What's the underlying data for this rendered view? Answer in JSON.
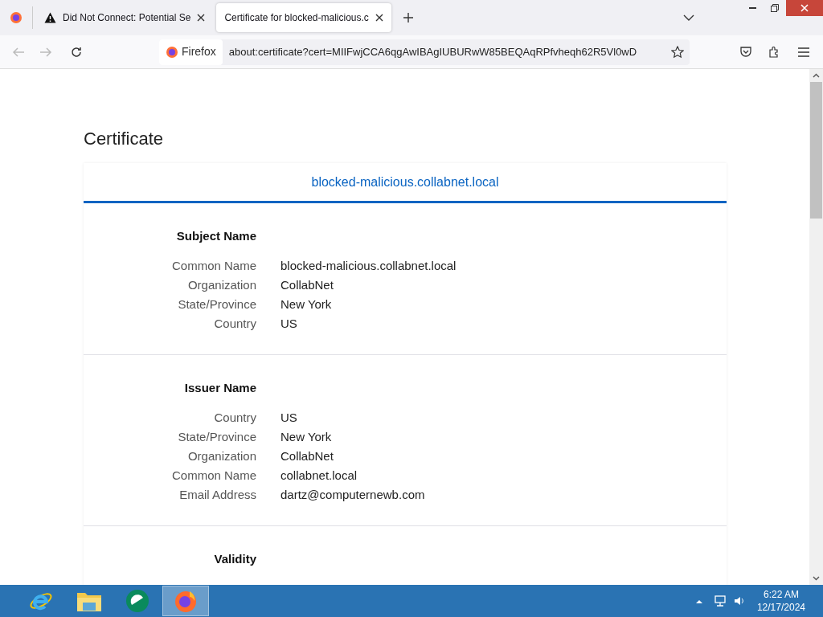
{
  "tabs": [
    {
      "label": "Did Not Connect: Potential Se",
      "kind": "warning",
      "selected": false
    },
    {
      "label": "Certificate for blocked-malicious.c",
      "kind": "plain",
      "selected": true
    }
  ],
  "address_bar": {
    "identity": "Firefox",
    "url": "about:certificate?cert=MIIFwjCCA6qgAwIBAgIUBURwW85BEQAqRPfvheqh62R5Vl0wD"
  },
  "page": {
    "title": "Certificate",
    "domain": "blocked-malicious.collabnet.local",
    "sections": [
      {
        "title": "Subject Name",
        "fields": [
          {
            "label": "Common Name",
            "value": "blocked-malicious.collabnet.local"
          },
          {
            "label": "Organization",
            "value": "CollabNet"
          },
          {
            "label": "State/Province",
            "value": "New York"
          },
          {
            "label": "Country",
            "value": "US"
          }
        ]
      },
      {
        "title": "Issuer Name",
        "fields": [
          {
            "label": "Country",
            "value": "US"
          },
          {
            "label": "State/Province",
            "value": "New York"
          },
          {
            "label": "Organization",
            "value": "CollabNet"
          },
          {
            "label": "Common Name",
            "value": "collabnet.local"
          },
          {
            "label": "Email Address",
            "value": "dartz@computernewb.com"
          }
        ]
      },
      {
        "title": "Validity"
      }
    ]
  },
  "taskbar": {
    "apps": [
      {
        "kind": "ie",
        "selected": false
      },
      {
        "kind": "explorer",
        "selected": false
      },
      {
        "kind": "green",
        "selected": false
      },
      {
        "kind": "firefox",
        "selected": true
      }
    ],
    "time": "6:22 AM",
    "date": "12/17/2024"
  }
}
